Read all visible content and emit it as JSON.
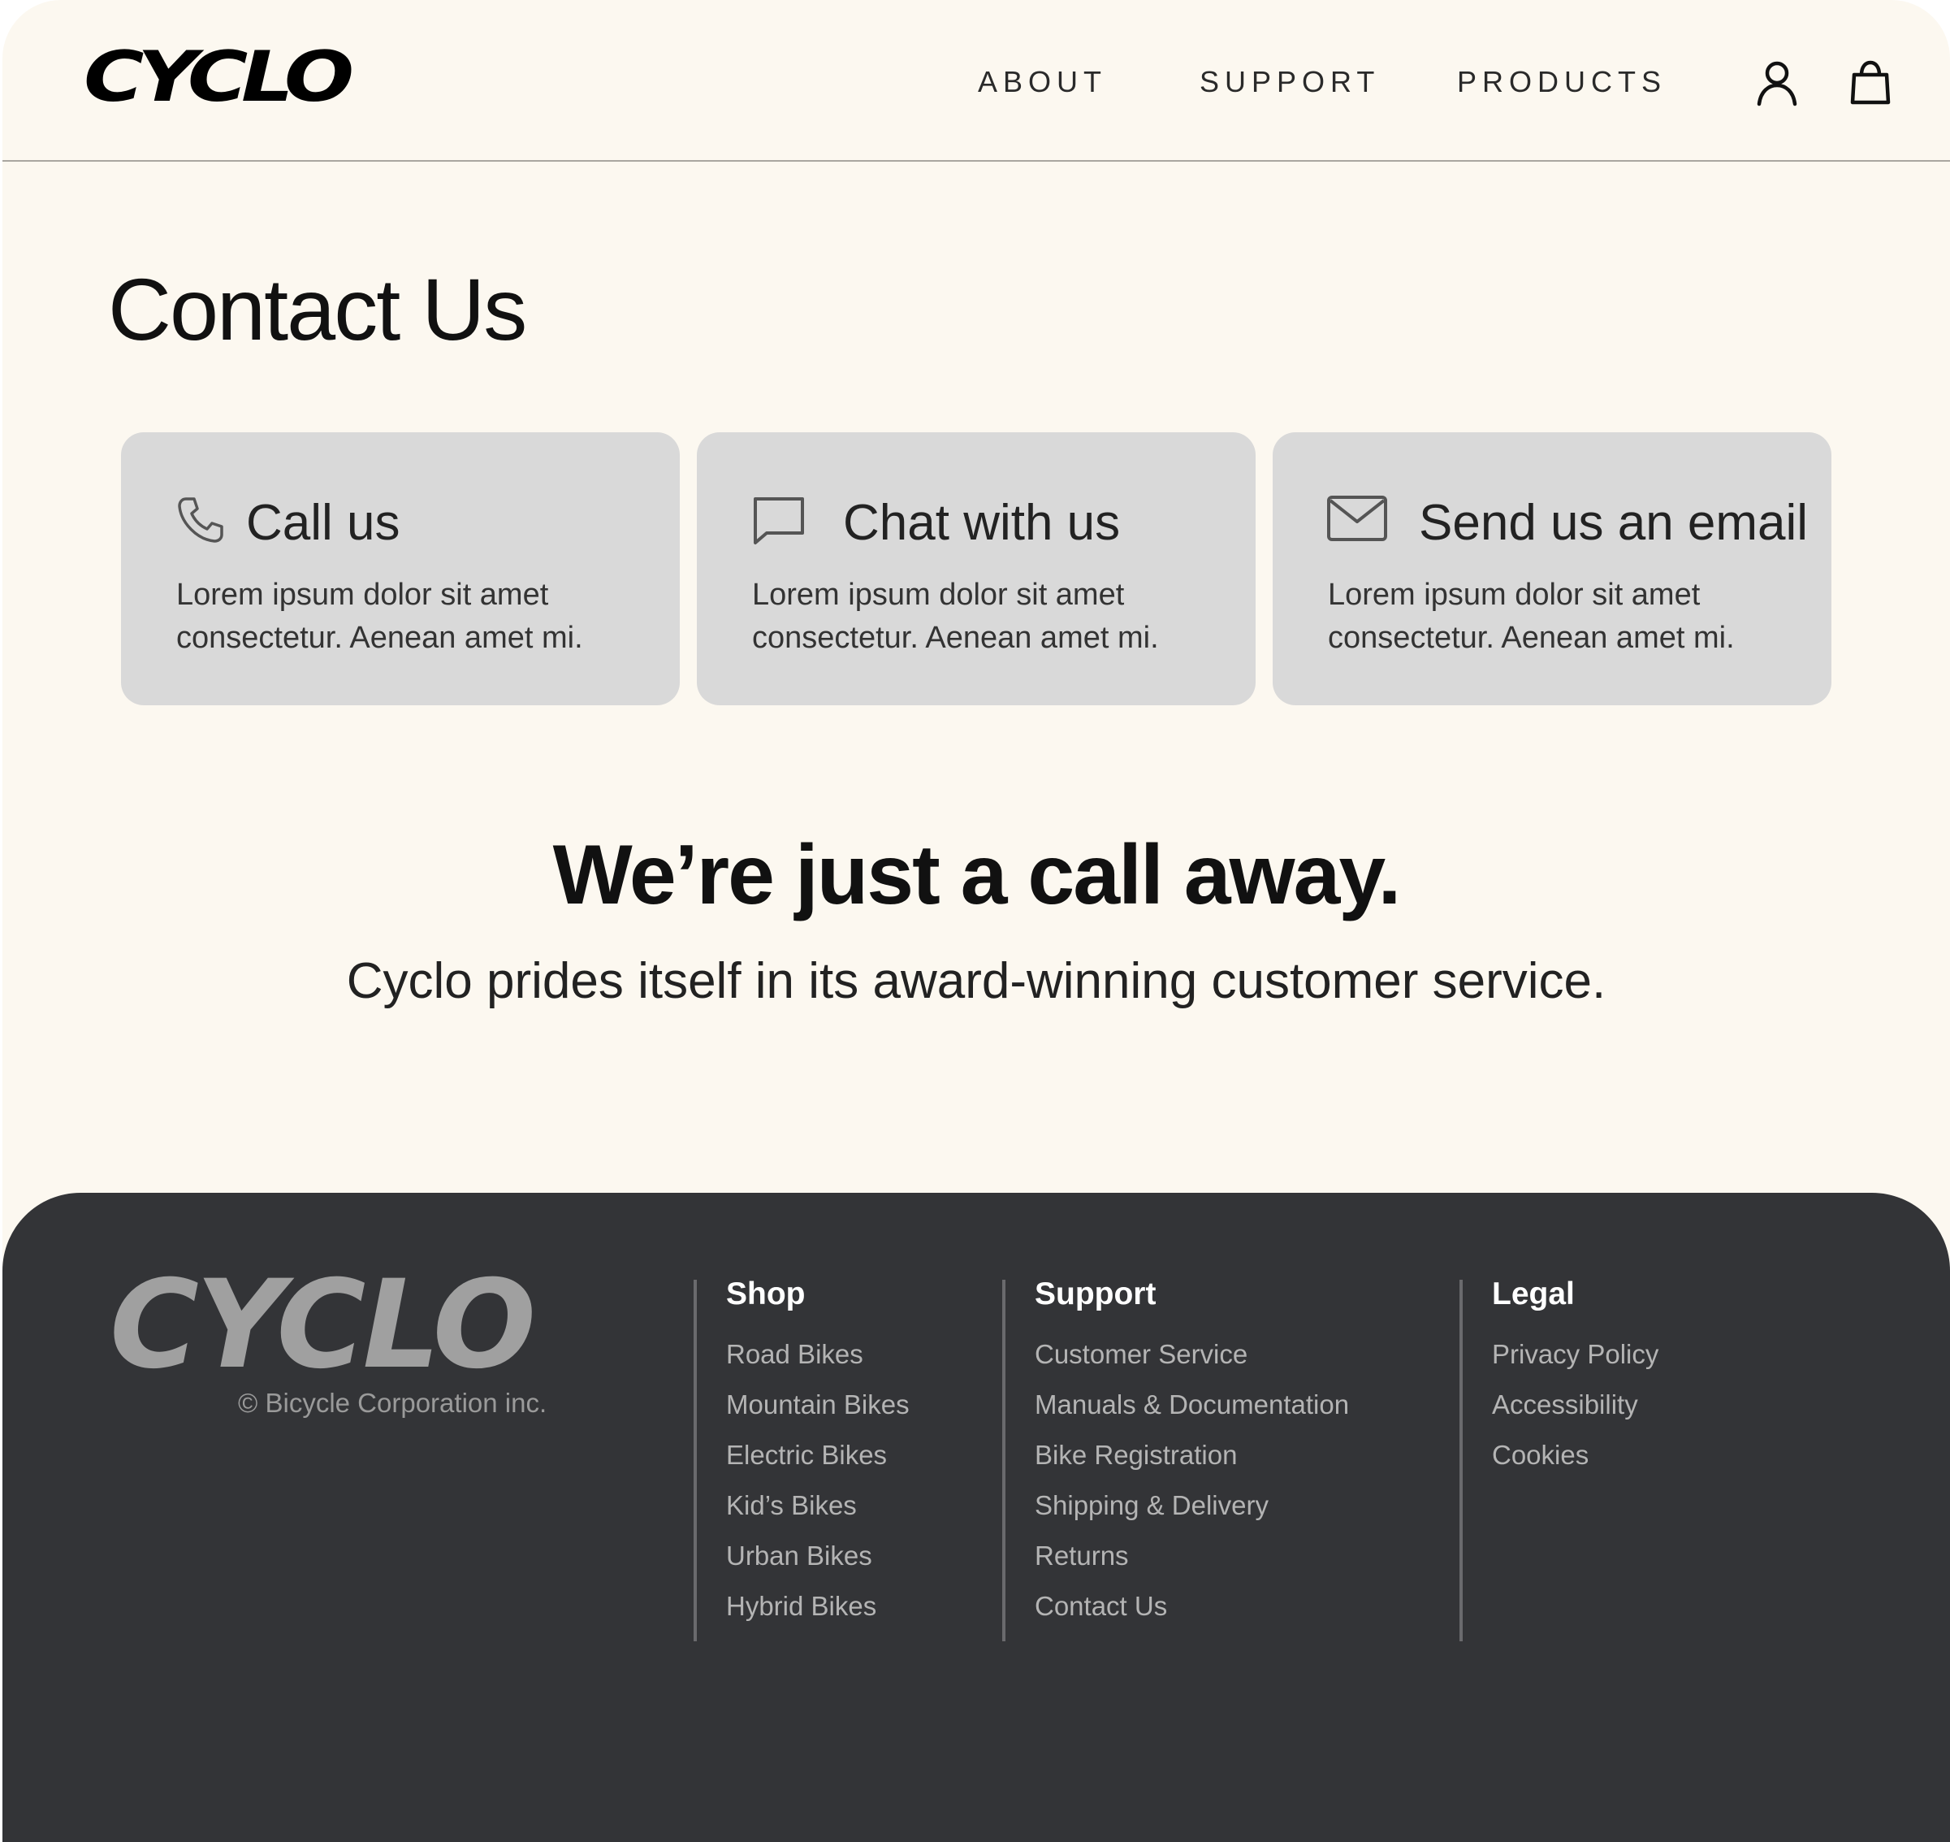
{
  "header": {
    "logo": "CYCLO",
    "nav": [
      {
        "label": "ABOUT"
      },
      {
        "label": "SUPPORT"
      },
      {
        "label": "PRODUCTS"
      }
    ]
  },
  "page": {
    "title": "Contact Us",
    "cards": [
      {
        "icon": "phone-icon",
        "title": "Call us",
        "text": "Lorem ipsum dolor sit amet consectetur. Aenean amet mi."
      },
      {
        "icon": "chat-icon",
        "title": "Chat with us",
        "text": "Lorem ipsum dolor sit amet consectetur. Aenean amet mi."
      },
      {
        "icon": "mail-icon",
        "title": "Send us an email",
        "text": "Lorem ipsum dolor sit amet consectetur. Aenean amet mi."
      }
    ],
    "tagline": "We’re just a call away.",
    "subtagline": "Cyclo prides itself in its award-winning customer service."
  },
  "footer": {
    "logo": "CYCLO",
    "copyright": "© Bicycle Corporation inc.",
    "columns": [
      {
        "heading": "Shop",
        "links": [
          "Road Bikes",
          "Mountain Bikes",
          "Electric Bikes",
          "Kid’s Bikes",
          "Urban Bikes",
          "Hybrid Bikes"
        ]
      },
      {
        "heading": "Support",
        "links": [
          "Customer Service",
          "Manuals & Documentation",
          "Bike Registration",
          "Shipping & Delivery",
          "Returns",
          "Contact Us"
        ]
      },
      {
        "heading": "Legal",
        "links": [
          "Privacy Policy",
          "Accessibility",
          "Cookies"
        ]
      }
    ]
  },
  "colors": {
    "background": "#fcf8f0",
    "card": "#d9d9d9",
    "footer": "#333437",
    "footer_logo": "#a0a0a0"
  }
}
